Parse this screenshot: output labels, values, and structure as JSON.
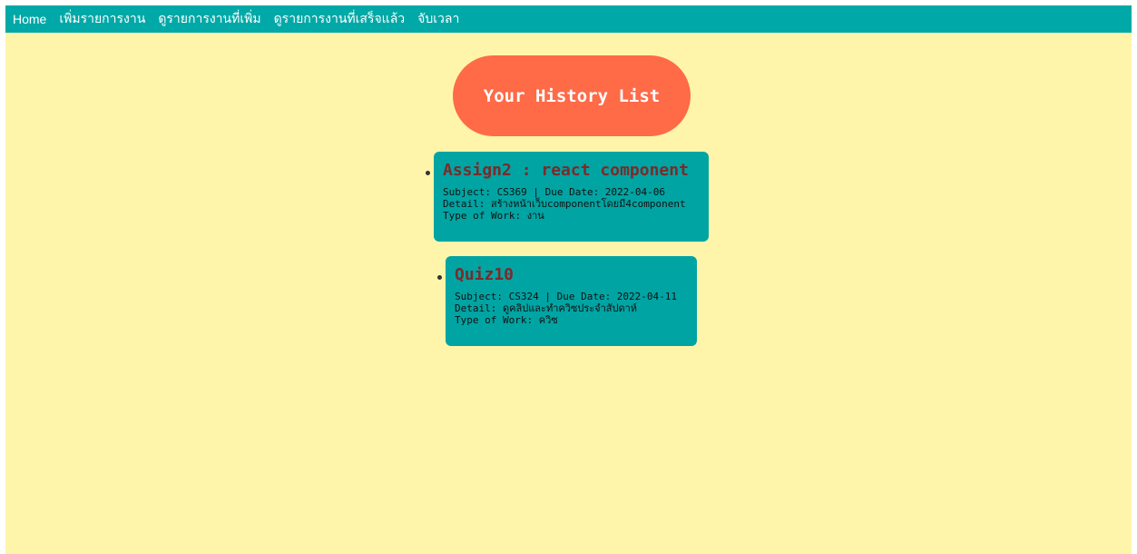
{
  "nav": {
    "items": [
      {
        "label": "Home"
      },
      {
        "label": "เพิ่มรายการงาน"
      },
      {
        "label": "ดูรายการงานที่เพิ่ม"
      },
      {
        "label": "ดูรายการงานที่เสร็จแล้ว"
      },
      {
        "label": "จับเวลา"
      }
    ]
  },
  "header": {
    "title": "Your History List"
  },
  "history": [
    {
      "title": "Assign2 : react component",
      "subject_line": "Subject: CS369 | Due Date: 2022-04-06",
      "detail_line": "Detail: สร้างหน้าเว็บcomponentโดยมี4component",
      "type_line": "Type of Work: งาน"
    },
    {
      "title": "Quiz10",
      "subject_line": "Subject: CS324 | Due Date: 2022-04-11",
      "detail_line": "Detail: ดูคลิปและทำควิซประจำสัปดาห์",
      "type_line": "Type of Work: ควิซ"
    }
  ],
  "colors": {
    "navbar": "#00a9a7",
    "background": "#fff5aa",
    "title_pill": "#ff6a47",
    "card": "#00a4a3",
    "card_title": "#7a2b2b"
  }
}
